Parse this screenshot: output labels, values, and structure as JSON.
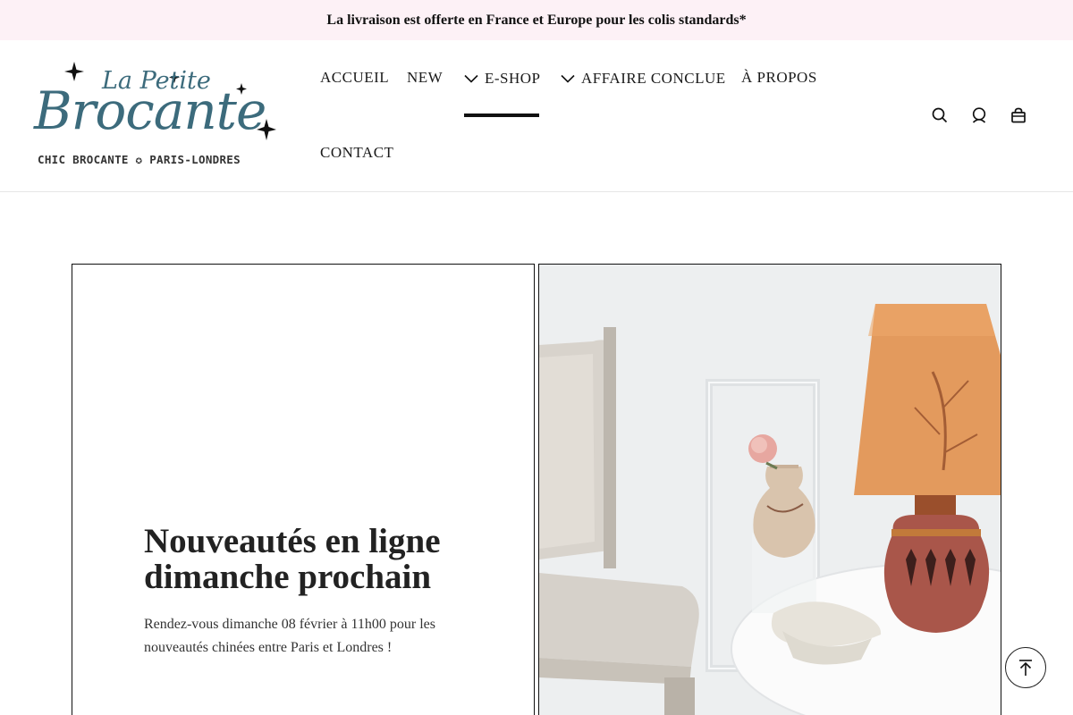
{
  "announcement": {
    "text": "La livraison est offerte en France et Europe pour les colis standards*"
  },
  "logo": {
    "line1": "La Petite",
    "line2": "Brocante",
    "tagline": "CHIC BROCANTE ✪ PARIS-LONDRES",
    "brand_color": "#3c6b7c"
  },
  "nav": {
    "items": [
      {
        "label": "ACCUEIL"
      },
      {
        "label": "NEW"
      },
      {
        "label": "E-SHOP",
        "has_dropdown": true,
        "active": true
      },
      {
        "label": "AFFAIRE CONCLUE",
        "has_dropdown": true
      },
      {
        "label": "À PROPOS"
      },
      {
        "label": "CONTACT"
      }
    ]
  },
  "header_icons": [
    "search-icon",
    "account-icon",
    "cart-icon"
  ],
  "hero": {
    "title": "Nouveautés en ligne dimanche prochain",
    "description": "Rendez-vous dimanche 08 février à 11h00 pour les nouveautés chinées entre Paris et Londres !"
  },
  "back_to_top": {
    "icon": "arrow-up-icon"
  },
  "colors": {
    "announcement_bg": "#fdf1f6",
    "text": "#1a1a1a",
    "border": "#111111"
  }
}
